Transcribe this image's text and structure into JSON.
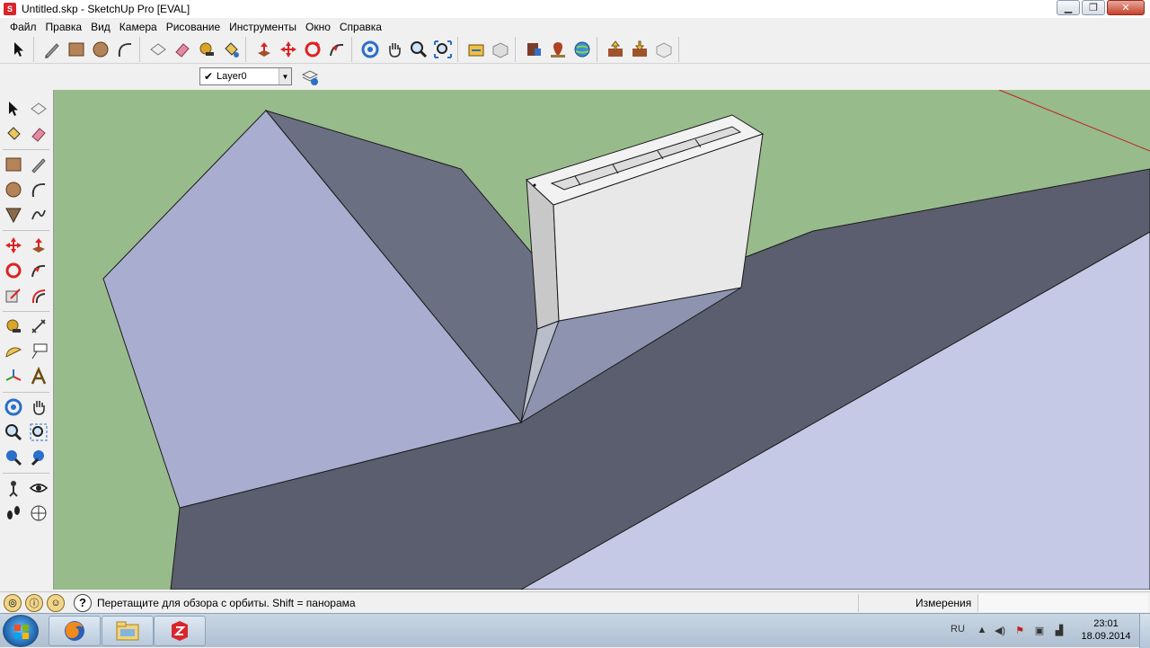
{
  "window": {
    "title": "Untitled.skp - SketchUp Pro [EVAL]",
    "logo_letter": "S"
  },
  "menu": [
    "Файл",
    "Правка",
    "Вид",
    "Камера",
    "Рисование",
    "Инструменты",
    "Окно",
    "Справка"
  ],
  "layer": {
    "check": "✔",
    "name": "Layer0"
  },
  "status": {
    "hint": "Перетащите для обзора с орбиты.  Shift = панорама",
    "measurements_label": "Измерения",
    "measurements_value": "",
    "help_glyph": "?"
  },
  "taskbar": {
    "language": "RU",
    "time": "23:01",
    "date": "18.09.2014"
  },
  "colors": {
    "sky_ground": "#98bb8b",
    "face_front": "#a9aed0",
    "face_back": "#5a5e6e",
    "face_light": "#c5c9e5"
  }
}
